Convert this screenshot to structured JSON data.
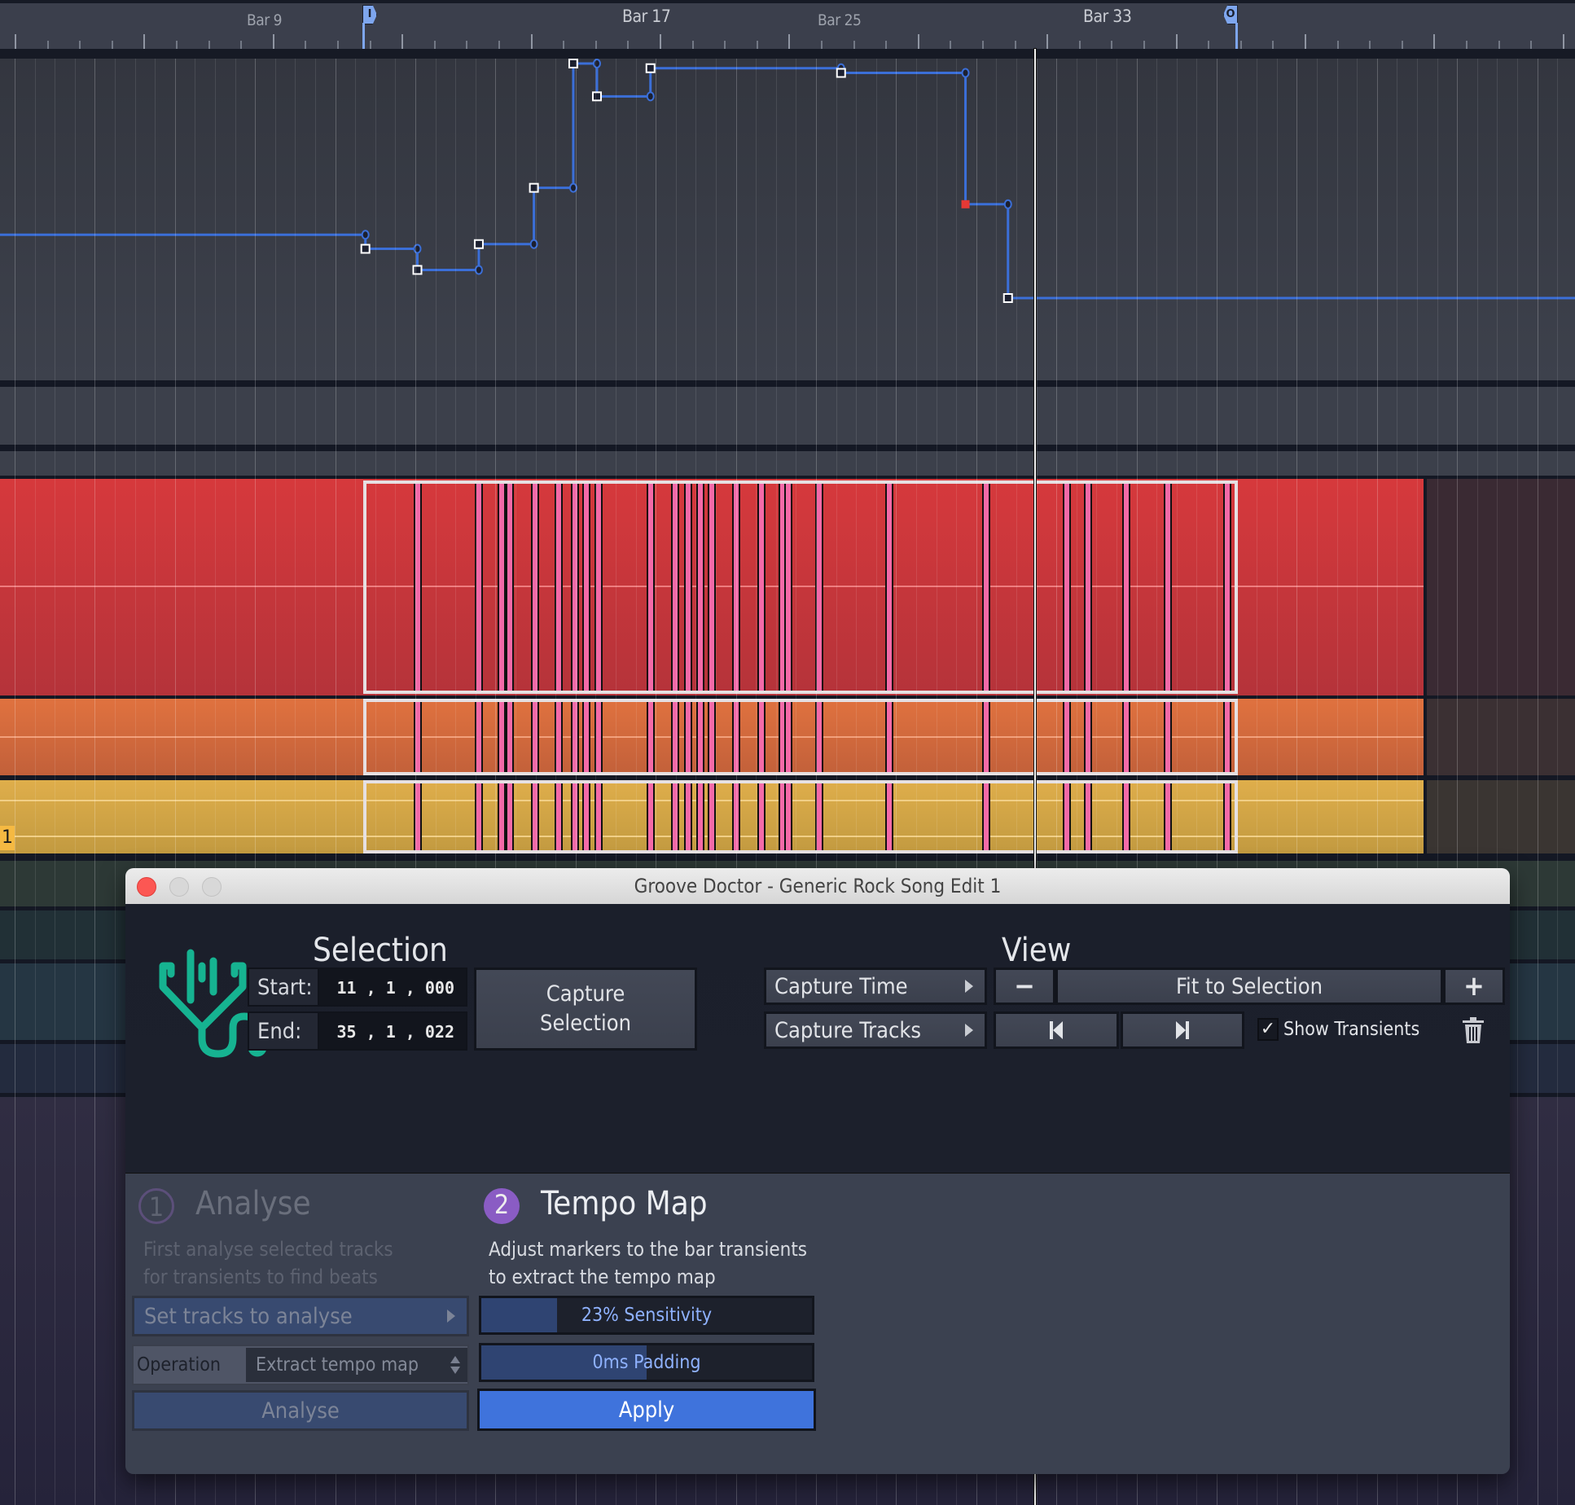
{
  "ruler": {
    "bar_labels": [
      {
        "text": "Bar 9",
        "dim": true
      },
      {
        "text": "Bar 17",
        "dim": false
      },
      {
        "text": "Bar 25",
        "dim": true
      },
      {
        "text": "Bar 33",
        "dim": false
      }
    ],
    "loop_start_flag": "I",
    "loop_end_flag": "O"
  },
  "tempo_curve": {
    "segments": [
      {
        "from": 0.0,
        "to": 0.232,
        "level": 0.27
      },
      {
        "from": 0.232,
        "to": 0.265,
        "level": 0.21
      },
      {
        "from": 0.265,
        "to": 0.304,
        "level": 0.12
      },
      {
        "from": 0.304,
        "to": 0.339,
        "level": 0.23
      },
      {
        "from": 0.339,
        "to": 0.364,
        "level": 0.47
      },
      {
        "from": 0.364,
        "to": 0.379,
        "level": 1.0
      },
      {
        "from": 0.379,
        "to": 0.413,
        "level": 0.86
      },
      {
        "from": 0.413,
        "to": 0.534,
        "level": 0.98
      },
      {
        "from": 0.534,
        "to": 0.613,
        "level": 0.96
      },
      {
        "from": 0.613,
        "to": 0.64,
        "level": 0.4
      },
      {
        "from": 0.64,
        "to": 1.0,
        "level": 0.0
      }
    ],
    "selected_point_index": 9,
    "colors": {
      "line": "#3b6fd8",
      "selected": "#e53935"
    }
  },
  "tracks": [
    {
      "name": "red-track",
      "color": "#d6393c",
      "transients": true
    },
    {
      "name": "orange-track",
      "color": "#e0723f",
      "transients": true
    },
    {
      "name": "yellow-track",
      "color": "#dfae4b",
      "transients": true,
      "marker_label": "1"
    }
  ],
  "transient_positions": [
    0.2646,
    0.3035,
    0.3182,
    0.3234,
    0.3392,
    0.3541,
    0.3645,
    0.3719,
    0.3793,
    0.4128,
    0.4283,
    0.4366,
    0.4441,
    0.4515,
    0.4671,
    0.4829,
    0.4962,
    0.5002,
    0.5198,
    0.5639,
    0.6259,
    0.6766,
    0.6901,
    0.7146,
    0.741,
    0.7789
  ],
  "dialog": {
    "title": "Groove Doctor - Generic Rock Song Edit 1",
    "selection": {
      "heading": "Selection",
      "start_label": "Start:",
      "start_value": "11 ,  1  , 000",
      "end_label": "End:",
      "end_value": "35 ,  1  , 022",
      "capture_selection_line1": "Capture",
      "capture_selection_line2": "Selection",
      "capture_time": "Capture Time",
      "capture_tracks": "Capture Tracks"
    },
    "view": {
      "heading": "View",
      "zoom_out": "−",
      "fit_to_selection": "Fit to Selection",
      "zoom_in": "+",
      "show_transients_label": "Show Transients",
      "show_transients_checked": true
    },
    "analyse": {
      "step_number": "1",
      "title": "Analyse",
      "description_line1": "First analyse selected tracks",
      "description_line2": "for transients to find beats",
      "set_tracks": "Set tracks to analyse",
      "operation_label": "Operation",
      "operation_value": "Extract tempo map",
      "analyse_button": "Analyse"
    },
    "tempo_map": {
      "step_number": "2",
      "title": "Tempo Map",
      "description_line1": "Adjust markers to the bar transients",
      "description_line2": "to extract the tempo map",
      "sensitivity_label": "23% Sensitivity",
      "sensitivity_value": 0.23,
      "padding_label": "0ms Padding",
      "padding_value": 0.5,
      "apply_button": "Apply"
    },
    "colors": {
      "accent_teal": "#16b391",
      "step_purple": "#8a5cc4",
      "apply_blue": "#3f73dc"
    }
  }
}
